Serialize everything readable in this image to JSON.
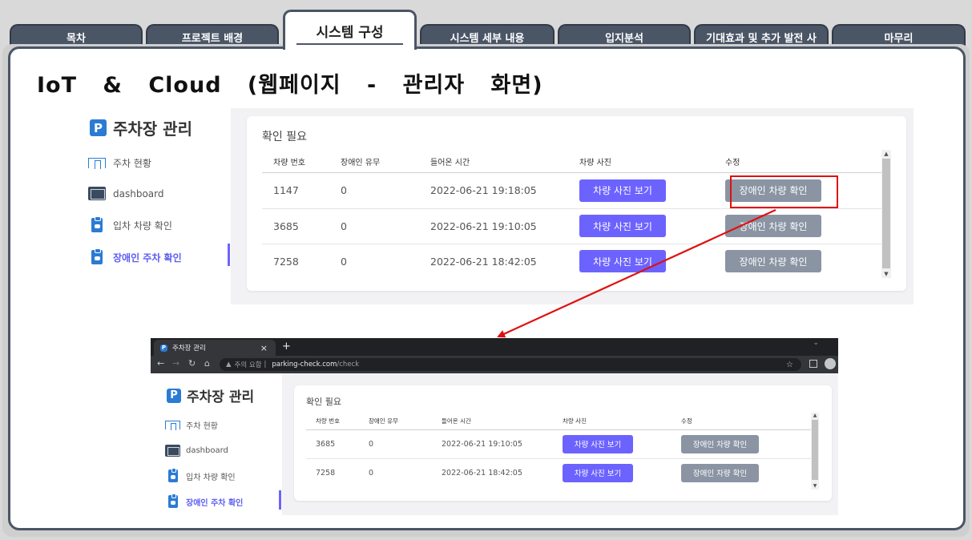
{
  "tabs": [
    {
      "label": "목차"
    },
    {
      "label": "프로젝트 배경"
    },
    {
      "label": "시스템 구성"
    },
    {
      "label": "시스템 세부 내용"
    },
    {
      "label": "입지분석"
    },
    {
      "label": "기대효과 및 추가 발전 사"
    },
    {
      "label": "마무리"
    }
  ],
  "slide": {
    "title": "IoT & Cloud (웹페이지 - 관리자 화면)"
  },
  "app": {
    "logo_badge": "P",
    "logo_text": "주차장 관리",
    "nav": [
      {
        "label": "주차 현황",
        "icon": "parking-gate-icon"
      },
      {
        "label": "dashboard",
        "icon": "dashboard-icon"
      },
      {
        "label": "입차 차량 확인",
        "icon": "clipboard-icon"
      },
      {
        "label": "장애인 주차 확인",
        "icon": "clipboard-icon",
        "active": true
      }
    ],
    "card_title": "확인 필요",
    "columns": [
      "차량 번호",
      "장애인 유무",
      "들어온 시간",
      "차량 사진",
      "수정"
    ],
    "photo_button": "차량 사진 보기",
    "confirm_button": "장애인 차량 확인",
    "rows_before": [
      {
        "number": "1147",
        "disabled": "0",
        "time": "2022-06-21 19:18:05"
      },
      {
        "number": "3685",
        "disabled": "0",
        "time": "2022-06-21 19:10:05"
      },
      {
        "number": "7258",
        "disabled": "0",
        "time": "2022-06-21 18:42:05"
      }
    ],
    "rows_after": [
      {
        "number": "3685",
        "disabled": "0",
        "time": "2022-06-21 19:10:05"
      },
      {
        "number": "7258",
        "disabled": "0",
        "time": "2022-06-21 18:42:05"
      }
    ]
  },
  "browser": {
    "tab_title": "주차장 관리",
    "tab_close": "×",
    "new_tab": "+",
    "warning": "주의 요함",
    "url_host": "parking-check.com",
    "url_path": "/check"
  },
  "colors": {
    "accent": "#6c63ff",
    "confirm": "#8a94a3",
    "highlight": "#e01010",
    "brand": "#2b7bd4"
  }
}
